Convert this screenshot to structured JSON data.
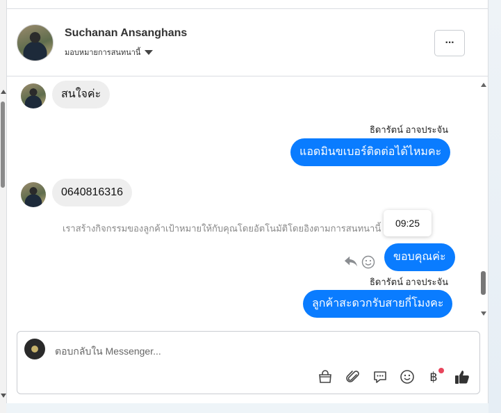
{
  "header": {
    "name": "Suchanan Ansanghans",
    "assign_label": "มอบหมายการสนทนานี้",
    "more_label": "···"
  },
  "messages": {
    "m1": "สนใจค่ะ",
    "sender1": "ธิดารัตน์ อาจประจัน",
    "m2": "แอดมินขเบอร์ติดต่อได้ไหมคะ",
    "m3": "0640816316",
    "system_note": "เราสร้างกิจกรรมของลูกค้าเป้าหมายให้กับคุณโดยอัตโนมัติโดยอิงตามการสนทนานี้",
    "tooltip_time": "09:25",
    "m4": "ขอบคุณค่ะ",
    "sender2": "ธิดารัตน์ อาจประจัน",
    "m5": "ลูกค้าสะดวกรับสายกี่โมงคะ"
  },
  "composer": {
    "placeholder": "ตอบกลับใน Messenger..."
  },
  "toolbar_icons": [
    "shopping-bag-icon",
    "paperclip-icon",
    "saved-replies-icon",
    "emoji-icon",
    "baht-payment-icon",
    "thumbs-up-icon"
  ],
  "baht_symbol": "฿",
  "colors": {
    "outgoing_bubble": "#0a7cff",
    "incoming_bubble": "#eeeeee",
    "notify_dot": "#e8455c"
  }
}
